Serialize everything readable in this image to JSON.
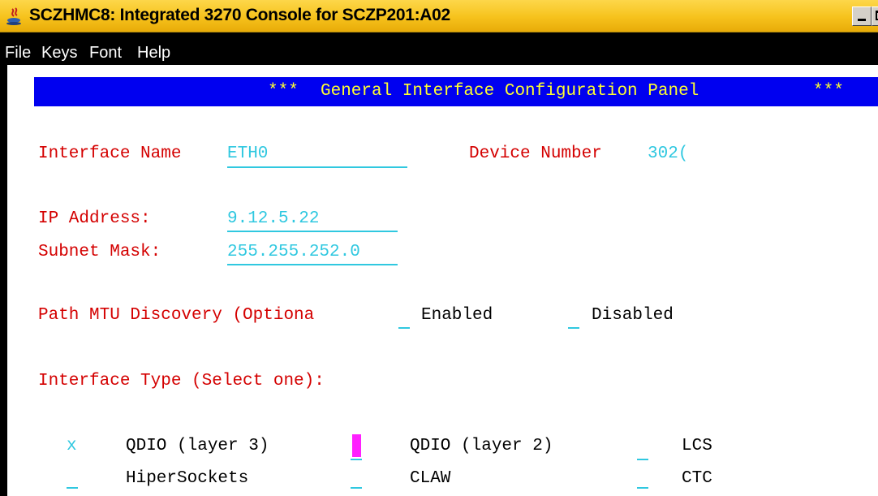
{
  "window": {
    "title": "SCZHMC8: Integrated 3270 Console for SCZP201:A02",
    "icon": "java-icon"
  },
  "menu": {
    "file": "File",
    "keys": "Keys",
    "font": "Font",
    "help": "Help"
  },
  "panel": {
    "header_stars_left": "***",
    "header_title": "General Interface Configuration Panel",
    "header_stars_right": "***",
    "interface_name_label": "Interface Name",
    "interface_name_value": "ETH0",
    "device_number_label": "Device Number",
    "device_number_value": "302(",
    "ip_address_label": "IP Address:",
    "ip_address_value": "9.12.5.22",
    "subnet_mask_label": "Subnet Mask:",
    "subnet_mask_value": "255.255.252.0",
    "path_mtu_label": "Path MTU Discovery (Optiona",
    "enabled_label": "Enabled",
    "disabled_label": "Disabled",
    "interface_type_label": "Interface Type (Select one):",
    "qdio_l3_selected": "x",
    "qdio_l3_label": "QDIO (layer 3)",
    "qdio_l2_label": "QDIO (layer 2)",
    "lcs_label": "LCS",
    "hipersockets_label": "HiperSockets",
    "claw_label": "CLAW",
    "ctc_label": "CTC"
  },
  "colors": {
    "label_red": "#d40000",
    "input_cyan": "#30c8e0",
    "header_blue": "#0000f0",
    "header_text_yellow": "#ffff30",
    "cursor_magenta": "#ff20ff",
    "titlebar_yellow": "#f6c21c"
  }
}
